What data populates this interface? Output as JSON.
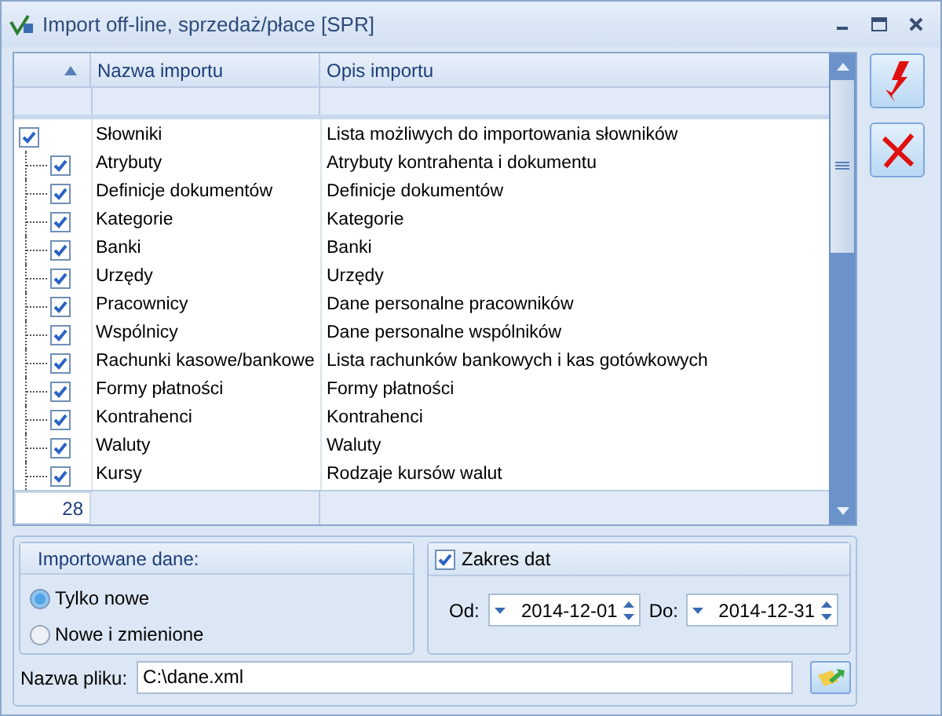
{
  "window": {
    "title": "Import off-line, sprzedaż/płace [SPR]"
  },
  "table": {
    "columns": [
      "Nazwa importu",
      "Opis importu"
    ],
    "rows": [
      {
        "name": "Słowniki",
        "description": "Lista możliwych do importowania słowników",
        "checked": true,
        "children": [
          {
            "name": "Atrybuty",
            "description": "Atrybuty kontrahenta i dokumentu",
            "checked": true
          },
          {
            "name": "Definicje dokumentów",
            "description": "Definicje dokumentów",
            "checked": true
          },
          {
            "name": "Kategorie",
            "description": "Kategorie",
            "checked": true
          },
          {
            "name": "Banki",
            "description": "Banki",
            "checked": true
          },
          {
            "name": "Urzędy",
            "description": "Urzędy",
            "checked": true
          },
          {
            "name": "Pracownicy",
            "description": "Dane personalne pracowników",
            "checked": true
          },
          {
            "name": "Wspólnicy",
            "description": "Dane personalne wspólników",
            "checked": true
          },
          {
            "name": "Rachunki kasowe/bankowe",
            "description": "Lista rachunków bankowych i kas gotówkowych",
            "checked": true
          },
          {
            "name": "Formy płatności",
            "description": "Formy płatności",
            "checked": true
          },
          {
            "name": "Kontrahenci",
            "description": "Kontrahenci",
            "checked": true
          },
          {
            "name": "Waluty",
            "description": "Waluty",
            "checked": true
          },
          {
            "name": "Kursy",
            "description": "Rodzaje kursów walut",
            "checked": true
          }
        ]
      }
    ],
    "count": "28"
  },
  "imported_data": {
    "title": "Importowane dane:",
    "options": [
      {
        "label": "Tylko nowe",
        "selected": true
      },
      {
        "label": "Nowe i zmienione",
        "selected": false
      }
    ]
  },
  "date_range": {
    "label": "Zakres dat",
    "checked": true,
    "from_label": "Od:",
    "from": "2014-12-01",
    "to_label": "Do:",
    "to": "2014-12-31"
  },
  "file": {
    "label": "Nazwa pliku:",
    "value": "C:\\dane.xml"
  }
}
